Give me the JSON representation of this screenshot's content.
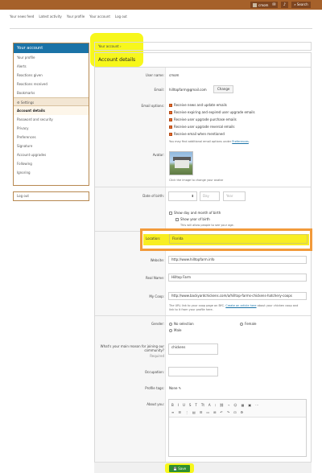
{
  "topbar": {
    "username": "cmom",
    "search_label": "Search"
  },
  "subnav": [
    "Your news feed",
    "Latest activity",
    "Your profile",
    "Your account",
    "Log out"
  ],
  "breadcrumb": "Your account",
  "page_title": "Account details",
  "sidebar": {
    "header": "Your account",
    "items": [
      "Your profile",
      "Alerts",
      "Reactions given",
      "Reactions received",
      "Bookmarks"
    ],
    "settings_section": "Settings",
    "settings_items": [
      "Account details",
      "Password and security",
      "Privacy",
      "Preferences",
      "Signature",
      "Account upgrades",
      "Following",
      "Ignoring"
    ],
    "active_item": "Account details",
    "logout": "Log out"
  },
  "form": {
    "username_label": "User name:",
    "username_value": "cmom",
    "email_label": "Email:",
    "email_value": "hilltopfarm@gmail.com",
    "email_change": "Change",
    "email_options_label": "Email options:",
    "email_options": [
      "Receive news and update emails",
      "Receive expiring and expired user upgrade emails",
      "Receive user upgrade purchase emails",
      "Receive user upgrade reversal emails",
      "Receive email when mentioned"
    ],
    "email_options_note_prefix": "You may find additional email options under",
    "email_options_note_link": "Preferences",
    "avatar_label": "Avatar:",
    "avatar_note": "Click the image to change your avatar",
    "dob_label": "Date of birth:",
    "dob_day_placeholder": "Day",
    "dob_year_placeholder": "Year",
    "dob_show_day_month": "Show day and month of birth",
    "dob_show_year": "Show year of birth",
    "dob_show_year_note": "This will allow people to see your age.",
    "location_label": "Location:",
    "location_value": "Florida",
    "website_label": "Website:",
    "website_value": "http://www.hilltopfarm.info",
    "realname_label": "Real Name:",
    "realname_value": "Hilltop Farm",
    "coop_label": "My Coop:",
    "coop_value": "http://www.backyardchickens.com/a/hilltop-farms-chickens-hatchery-coops",
    "coop_note_1": "The URL link to your coop page on BYC.",
    "coop_note_link": "Create an article here",
    "coop_note_2": "about your chicken coop and",
    "coop_note_3": "link to it from your profile here.",
    "gender_label": "Gender:",
    "gender_options": [
      "No selection",
      "Female",
      "Male"
    ],
    "reason_label": "What's your main reason for joining our community?",
    "reason_required": "Required",
    "reason_value": "chickens",
    "occupation_label": "Occupation:",
    "occupation_value": "",
    "profile_tags_label": "Profile tags:",
    "profile_tags_value": "None",
    "about_label": "About you:",
    "editor_toolbar_row1": [
      "B",
      "I",
      "U",
      "S",
      "T",
      "Tt",
      "A",
      "⁝",
      "⛓",
      "⌁",
      "☺",
      "▦",
      "▣",
      "⋯"
    ],
    "editor_toolbar_row2": [
      "≡",
      "☰",
      "⋮",
      "▤",
      "☰",
      "▭",
      "⊞",
      "↶",
      "↷",
      "⊡",
      "⚙"
    ],
    "save_label": "Save"
  },
  "colors": {
    "topbar": "#a6612a",
    "sidebar_header": "#1b73a7",
    "highlight_yellow": "#f7f71c",
    "location_border": "#f29a3a",
    "save_button": "#2f8f2f"
  }
}
